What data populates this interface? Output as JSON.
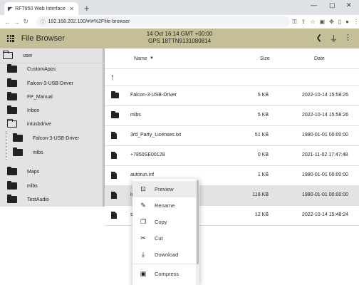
{
  "browser": {
    "tab_title": "RFT850 Web Interface",
    "new_tab": "+",
    "url": "192.168.202.100/#!#%2Ffile-browser",
    "controls": {
      "minimize": "—",
      "maximize": "▢",
      "close": "✕"
    }
  },
  "app": {
    "title": "File Browser",
    "clock": "14 Oct 16:14 GMT +00:00",
    "gps": "GPS  18TTN9131080814"
  },
  "sidebar": {
    "root": "user",
    "items": [
      "CustomApps",
      "Falcon-3-USB-Driver",
      "FP_Manual",
      "Inbox",
      "intusbdrive"
    ],
    "sub_items": [
      "Falcon-3-USB-Driver",
      "mlbs"
    ],
    "after": [
      "Maps",
      "mlbs",
      "TestAudio"
    ]
  },
  "table": {
    "headers": {
      "name": "Name",
      "sort_arrow": "▼",
      "size": "Size",
      "date": "Date"
    },
    "up_arrow": "↑",
    "rows": [
      {
        "name": "Falcon-3-USB-Driver",
        "size": "5 KB",
        "date": "2022-10-14 15:58:26",
        "icon": "folder"
      },
      {
        "name": "mlbs",
        "size": "5 KB",
        "date": "2022-10-14 15:58:26",
        "icon": "folder"
      },
      {
        "name": "3rd_Party_Licenses.txt",
        "size": "51 KB",
        "date": "1980-01-01 00:00:00",
        "icon": "file"
      },
      {
        "name": "+7850SE00128",
        "size": "0 KB",
        "date": "2021-11-02 17:47:48",
        "icon": "file"
      },
      {
        "name": "autorun.inf",
        "size": "1 KB",
        "date": "1980-01-01 00:00:00",
        "icon": "file"
      },
      {
        "name": "ic",
        "size": "118 KB",
        "date": "1980-01-01 00:00:00",
        "icon": "file"
      },
      {
        "name": "sy",
        "size": "12 KB",
        "date": "2022-10-14 15:48:24",
        "icon": "file"
      }
    ]
  },
  "context_menu": {
    "items": [
      "Preview",
      "Rename",
      "Copy",
      "Cut",
      "Download",
      "Compress"
    ]
  },
  "colors": {
    "appbar": "#c5bf98",
    "selected_row": "#e3e3e3"
  }
}
